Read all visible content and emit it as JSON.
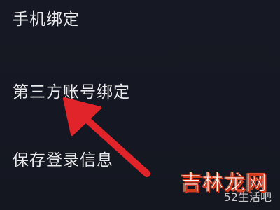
{
  "menu": {
    "items": [
      {
        "label": "手机绑定"
      },
      {
        "label": "第三方账号绑定"
      },
      {
        "label": "保存登录信息"
      }
    ]
  },
  "annotation": {
    "arrow_color": "#e0242a",
    "arrow_icon": "red-pointer-arrow-icon"
  },
  "watermark": {
    "logo_text": "吉林龙网",
    "url_text": "52生活吧"
  },
  "colors": {
    "background": "#161922",
    "text": "#e9e9ec"
  }
}
